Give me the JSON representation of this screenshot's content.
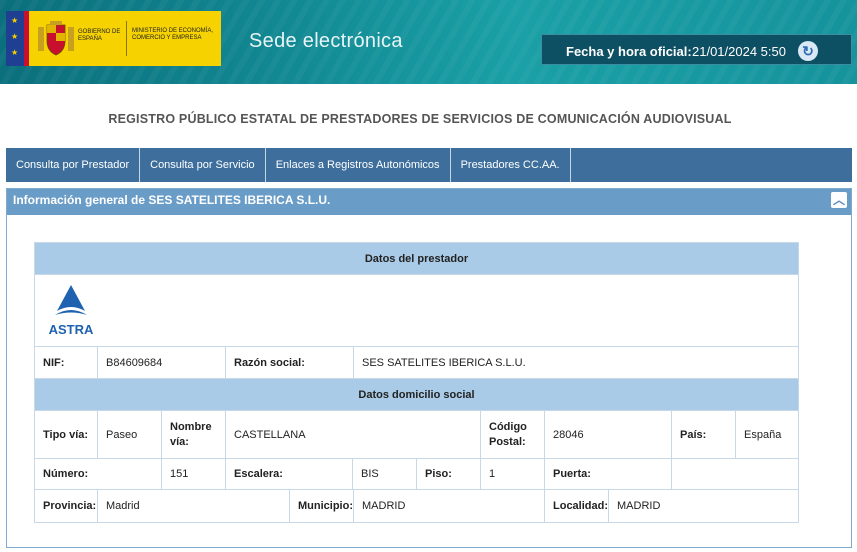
{
  "header": {
    "gobierno_text": "GOBIERNO DE ESPAÑA",
    "ministerio_text": "MINISTERIO DE ECONOMÍA, COMERCIO Y EMPRESA",
    "sede_title": "Sede electrónica",
    "clock_label": "Fecha y hora oficial:",
    "clock_value": "21/01/2024 5:50"
  },
  "page_title": "REGISTRO PÚBLICO ESTATAL DE PRESTADORES DE SERVICIOS DE COMUNICACIÓN AUDIOVISUAL",
  "nav": {
    "tabs": [
      "Consulta por Prestador",
      "Consulta por Servicio",
      "Enlaces a Registros Autonómicos",
      "Prestadores CC.AA."
    ]
  },
  "panel": {
    "title": "Información general de SES SATELITES IBERICA S.L.U."
  },
  "prestador": {
    "section_title": "Datos del prestador",
    "logo_text": "ASTRA",
    "nif_label": "NIF:",
    "nif_value": "B84609684",
    "razon_label": "Razón social:",
    "razon_value": "SES SATELITES IBERICA S.L.U."
  },
  "domicilio": {
    "section_title": "Datos domicilio social",
    "tipo_via_label": "Tipo vía:",
    "tipo_via_value": "Paseo",
    "nombre_via_label": "Nombre vía:",
    "nombre_via_value": "CASTELLANA",
    "codigo_postal_label": "Código Postal:",
    "codigo_postal_value": "28046",
    "pais_label": "País:",
    "pais_value": "España",
    "numero_label": "Número:",
    "numero_value": "151",
    "escalera_label": "Escalera:",
    "escalera_value": "BIS",
    "piso_label": "Piso:",
    "piso_value": "1",
    "puerta_label": "Puerta:",
    "puerta_value": "",
    "provincia_label": "Provincia:",
    "provincia_value": "Madrid",
    "municipio_label": "Municipio:",
    "municipio_value": "MADRID",
    "localidad_label": "Localidad:",
    "localidad_value": "MADRID"
  },
  "colors": {
    "nav_bg": "#3e6f9c",
    "panel_header": "#6a9cc8",
    "section_header": "#a9cbe7",
    "astra_blue": "#1e62b0"
  },
  "icons": {
    "refresh": "refresh-icon",
    "collapse": "chevron-up-icon"
  }
}
